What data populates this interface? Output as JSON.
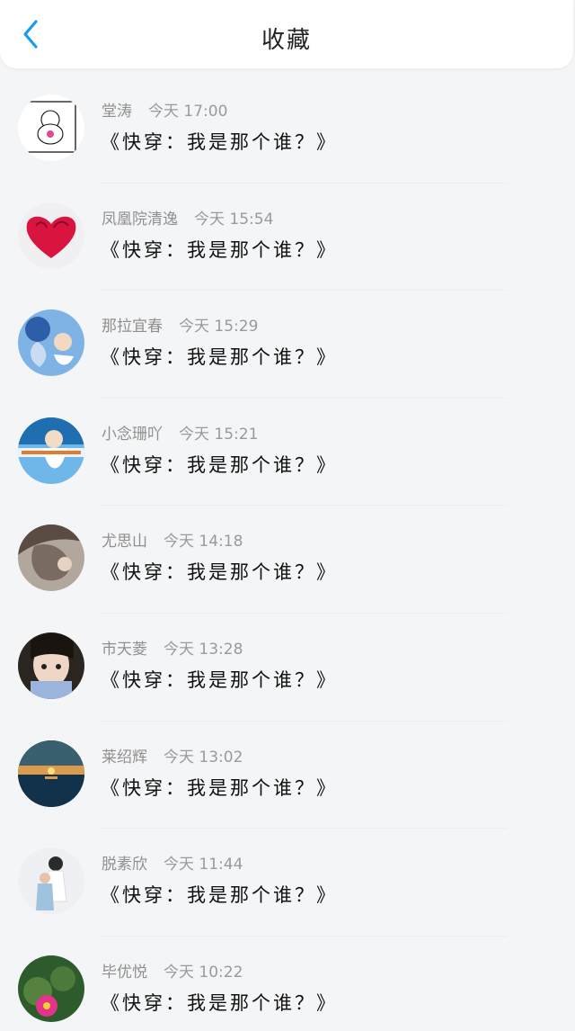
{
  "header": {
    "title": "收藏",
    "back_icon": "chevron-left-icon",
    "accent_color": "#1a9af2"
  },
  "favorites": [
    {
      "name": "堂涛",
      "time": "今天 17:00",
      "text": "《快穿：我是那个谁？》",
      "avatar_icon": "cartoon-avatar"
    },
    {
      "name": "凤凰院清逸",
      "time": "今天 15:54",
      "text": "《快穿：我是那个谁？》",
      "avatar_icon": "rose-heart-avatar"
    },
    {
      "name": "那拉宜春",
      "time": "今天 15:29",
      "text": "《快穿：我是那个谁？》",
      "avatar_icon": "anime-couple-avatar"
    },
    {
      "name": "小念珊吖",
      "time": "今天 15:21",
      "text": "《快穿：我是那个谁？》",
      "avatar_icon": "girl-photo-avatar"
    },
    {
      "name": "尤思山",
      "time": "今天 14:18",
      "text": "《快穿：我是那个谁？》",
      "avatar_icon": "hair-avatar"
    },
    {
      "name": "市天菱",
      "time": "今天 13:28",
      "text": "《快穿：我是那个谁？》",
      "avatar_icon": "girl-face-avatar"
    },
    {
      "name": "莱绍辉",
      "time": "今天 13:02",
      "text": "《快穿：我是那个谁？》",
      "avatar_icon": "sunset-avatar"
    },
    {
      "name": "脱素欣",
      "time": "今天 11:44",
      "text": "《快穿：我是那个谁？》",
      "avatar_icon": "couple-avatar"
    },
    {
      "name": "毕优悦",
      "time": "今天 10:22",
      "text": "《快穿：我是那个谁？》",
      "avatar_icon": "cactus-flower-avatar"
    }
  ]
}
